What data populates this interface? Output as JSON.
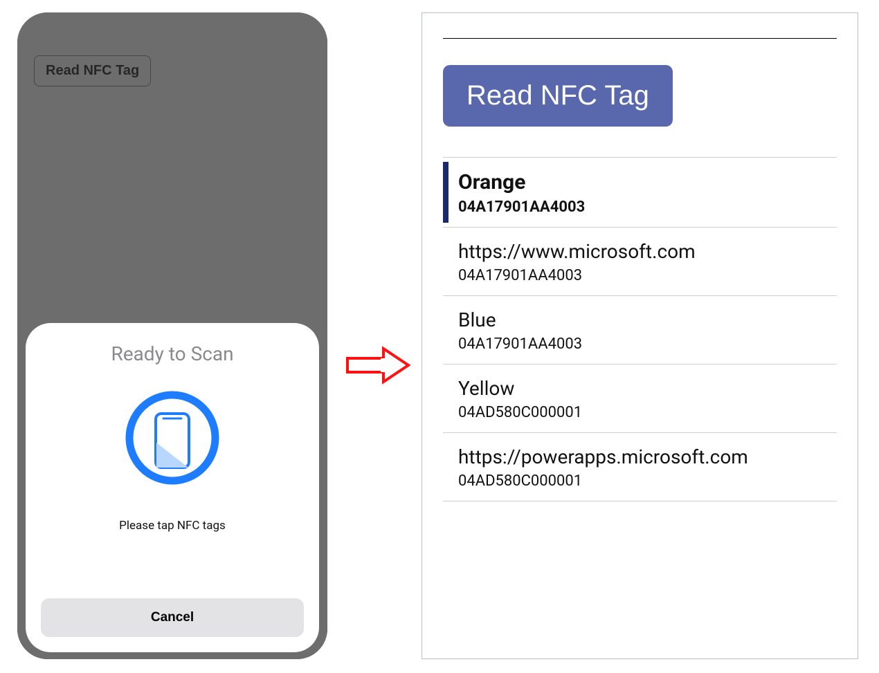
{
  "left": {
    "background_button_label": "Read NFC Tag",
    "sheet": {
      "title": "Ready to Scan",
      "subtitle": "Please tap NFC tags",
      "cancel_label": "Cancel"
    }
  },
  "right": {
    "read_button_label": "Read NFC Tag",
    "items": [
      {
        "title": "Orange",
        "sub": "04A17901AA4003",
        "selected": true
      },
      {
        "title": "https://www.microsoft.com",
        "sub": "04A17901AA4003",
        "selected": false
      },
      {
        "title": "Blue",
        "sub": "04A17901AA4003",
        "selected": false
      },
      {
        "title": "Yellow",
        "sub": "04AD580C000001",
        "selected": false
      },
      {
        "title": "https://powerapps.microsoft.com",
        "sub": "04AD580C000001",
        "selected": false
      }
    ]
  },
  "arrow": {
    "color": "#ff0000"
  }
}
